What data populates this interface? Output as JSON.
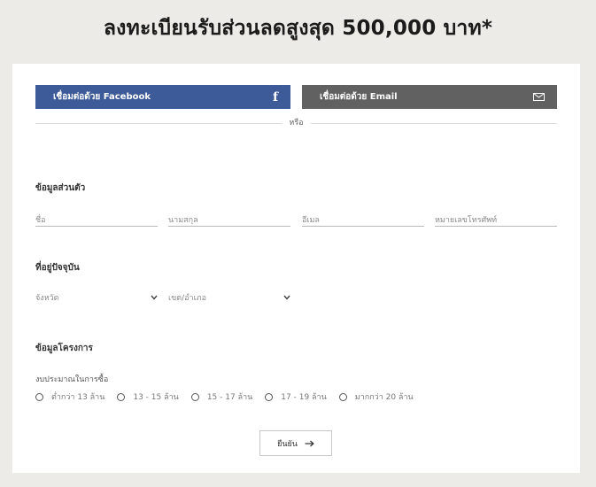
{
  "page": {
    "title": "ลงทะเบียนรับส่วนลดสูงสุด 500,000 บาท*"
  },
  "social": {
    "facebook_label": "เชื่อมต่อด้วย Facebook",
    "email_label": "เชื่อมต่อด้วย Email",
    "facebook_icon": "f",
    "divider_text": "หรือ"
  },
  "personal": {
    "heading": "ข้อมูลส่วนตัว",
    "first_name_placeholder": "ชื่อ",
    "last_name_placeholder": "นามสกุล",
    "email_placeholder": "อีเมล",
    "phone_placeholder": "หมายเลขโทรศัพท์"
  },
  "address": {
    "heading": "ที่อยู่ปัจจุบัน",
    "province_label": "จังหวัด",
    "district_label": "เขต/อำเภอ"
  },
  "project": {
    "heading": "ข้อมูลโครงการ",
    "budget_label": "งบประมาณในการซื้อ",
    "budget_options": [
      "ต่ำกว่า 13 ล้าน",
      "13 - 15 ล้าน",
      "15 - 17 ล้าน",
      "17 - 19 ล้าน",
      "มากกว่า 20 ล้าน"
    ]
  },
  "submit": {
    "label": "ยืนยัน"
  },
  "colors": {
    "facebook": "#3d5a99",
    "email": "#616161",
    "background": "#ecebe7"
  }
}
